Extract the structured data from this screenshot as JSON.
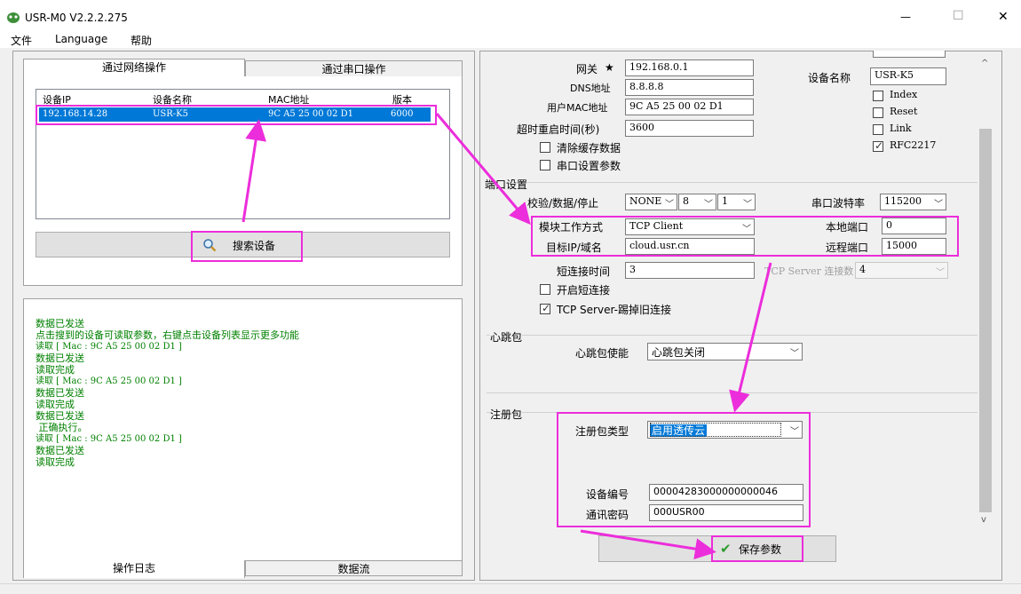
{
  "window": {
    "title": "USR-M0 V2.2.2.275",
    "menu": [
      "文件",
      "Language",
      "帮助"
    ],
    "buttons": {
      "min": "—",
      "max": "☐",
      "close": "✕"
    }
  },
  "left": {
    "tabs": [
      "通过网络操作",
      "通过串口操作"
    ],
    "table": {
      "headers": [
        "设备IP",
        "设备名称",
        "MAC地址",
        "版本"
      ],
      "rows": [
        [
          "192.168.14.28",
          "USR-K5",
          "9C A5 25 00 02 D1",
          "6000"
        ]
      ]
    },
    "search_button": "搜索设备",
    "log": [
      "数据已发送",
      "点击搜到的设备可读取参数，右键点击设备列表显示更多功能",
      "读取 [ Mac : 9C A5 25 00 02 D1 ]",
      "数据已发送",
      "读取完成",
      "读取 [ Mac : 9C A5 25 00 02 D1 ]",
      "数据已发送",
      "读取完成",
      "数据已发送",
      " 正确执行。",
      "读取 [ Mac : 9C A5 25 00 02 D1 ]",
      "数据已发送",
      "读取完成"
    ],
    "bottom_tabs": [
      "操作日志",
      "数据流"
    ]
  },
  "right": {
    "gateway_label": "网关",
    "gateway_star": "★",
    "gateway": "192.168.0.1",
    "dns_label": "DNS地址",
    "dns": "8.8.8.8",
    "mac_label": "用户MAC地址",
    "mac": "9C A5 25 00 02 D1",
    "timeout_label": "超时重启时间(秒)",
    "timeout": "3600",
    "clear_cache": "清除缓存数据",
    "serial_params": "串口设置参数",
    "device_name_label": "设备名称",
    "device_name": "USR-K5",
    "checks": [
      "Index",
      "Reset",
      "Link",
      "RFC2217"
    ],
    "port_section": "端口设置",
    "parity_label": "校验/数据/停止",
    "parity": "NONE",
    "databits": "8",
    "stopbits": "1",
    "baud_label": "串口波特率",
    "baud": "115200",
    "mode_label": "模块工作方式",
    "mode": "TCP Client",
    "local_port_label": "本地端口",
    "local_port": "0",
    "target_label": "目标IP/域名",
    "target": "cloud.usr.cn",
    "remote_port_label": "远程端口",
    "remote_port": "15000",
    "short_time_label": "短连接时间",
    "short_time": "3",
    "tcp_server_label": "TCP Server 连接数",
    "tcp_server_count": "4",
    "open_short": "开启短连接",
    "kick_old": "TCP Server-踢掉旧连接",
    "heartbeat_section": "心跳包",
    "heartbeat_label": "心跳包使能",
    "heartbeat_value": "心跳包关闭",
    "register_section": "注册包",
    "register_type_label": "注册包类型",
    "register_type": "启用透传云",
    "device_id_label": "设备编号",
    "device_id": "00004283000000000046",
    "password_label": "通讯密码",
    "password": "000USR00",
    "save_button": "保存参数"
  },
  "colors": {
    "accent_pink": "#ec2ddb",
    "selection": "#0078d7",
    "log_green": "#008000"
  }
}
